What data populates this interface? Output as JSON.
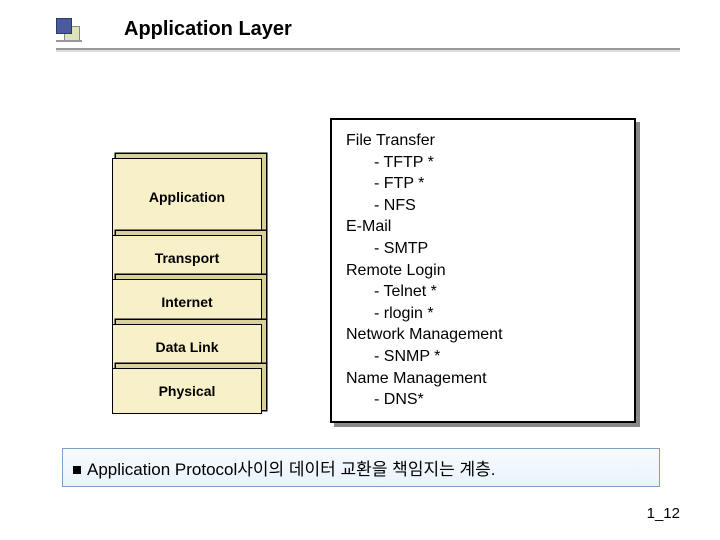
{
  "title": "Application Layer",
  "layers": {
    "l0": "Application",
    "l1": "Transport",
    "l2": "Internet",
    "l3": "Data Link",
    "l4": "Physical"
  },
  "protocols": {
    "g0": "File Transfer",
    "g0i0": "- TFTP *",
    "g0i1": "- FTP *",
    "g0i2": "- NFS",
    "g1": "E-Mail",
    "g1i0": "- SMTP",
    "g2": "Remote Login",
    "g2i0": "- Telnet *",
    "g2i1": "- rlogin *",
    "g3": "Network Management",
    "g3i0": "- SNMP *",
    "g4": "Name Management",
    "g4i0": "- DNS*"
  },
  "caption": "Application Protocol사이의 데이터 교환을 책임지는 계층.",
  "pagenum": "1_12"
}
